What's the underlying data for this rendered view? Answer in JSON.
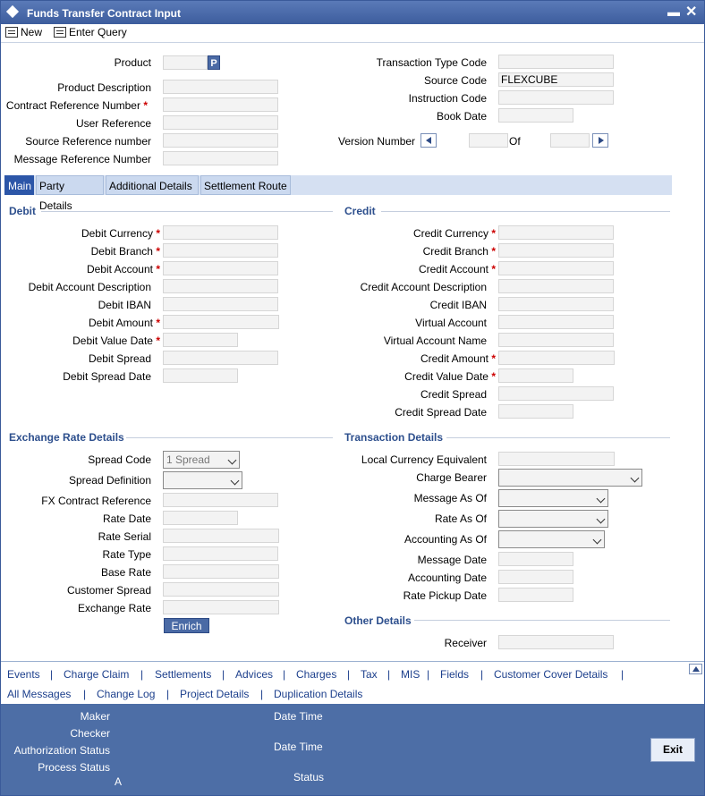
{
  "window": {
    "title": "Funds Transfer Contract Input",
    "minimize": "▬",
    "close": "✕"
  },
  "toolbar": {
    "new": "New",
    "enter_query": "Enter Query"
  },
  "header": {
    "product": "Product",
    "product_btn": "P",
    "product_description": "Product Description",
    "contract_reference_number": "Contract Reference Number",
    "user_reference": "User Reference",
    "source_reference_number": "Source Reference number",
    "message_reference_number": "Message Reference Number",
    "transaction_type_code": "Transaction Type Code",
    "source_code": "Source Code",
    "source_code_value": "FLEXCUBE",
    "instruction_code": "Instruction Code",
    "book_date": "Book Date",
    "version_number": "Version Number",
    "of": "Of"
  },
  "tabs": [
    "Main",
    "Party Details",
    "Additional Details",
    "Settlement Route"
  ],
  "debit": {
    "heading": "Debit",
    "currency": "Debit Currency",
    "branch": "Debit Branch",
    "account": "Debit Account",
    "account_description": "Debit Account Description",
    "iban": "Debit IBAN",
    "amount": "Debit Amount",
    "value_date": "Debit Value Date",
    "spread": "Debit Spread",
    "spread_date": "Debit Spread Date"
  },
  "credit": {
    "heading": "Credit",
    "currency": "Credit Currency",
    "branch": "Credit Branch",
    "account": "Credit Account",
    "account_description": "Credit Account Description",
    "iban": "Credit IBAN",
    "virtual_account": "Virtual Account",
    "virtual_account_name": "Virtual Account Name",
    "amount": "Credit Amount",
    "value_date": "Credit Value Date",
    "spread": "Credit Spread",
    "spread_date": "Credit Spread Date"
  },
  "exchange": {
    "heading": "Exchange Rate Details",
    "spread_code": "Spread Code",
    "spread_code_value": "1 Spread",
    "spread_definition": "Spread Definition",
    "fx_contract_reference": "FX Contract Reference",
    "rate_date": "Rate Date",
    "rate_serial": "Rate Serial",
    "rate_type": "Rate Type",
    "base_rate": "Base Rate",
    "customer_spread": "Customer Spread",
    "exchange_rate": "Exchange Rate",
    "enrich": "Enrich"
  },
  "transaction": {
    "heading": "Transaction Details",
    "local_currency_equivalent": "Local Currency Equivalent",
    "charge_bearer": "Charge Bearer",
    "message_as_of": "Message As Of",
    "rate_as_of": "Rate As Of",
    "accounting_as_of": "Accounting As Of",
    "message_date": "Message Date",
    "accounting_date": "Accounting Date",
    "rate_pickup_date": "Rate Pickup Date"
  },
  "other": {
    "heading": "Other Details",
    "receiver": "Receiver"
  },
  "footer_links": {
    "row1": [
      "Events",
      "Charge Claim",
      "Settlements",
      "Advices",
      "Charges",
      "Tax",
      "MIS",
      "Fields",
      "Customer Cover Details"
    ],
    "row2": [
      "All Messages",
      "Change Log",
      "Project Details",
      "Duplication Details"
    ],
    "separator": "|"
  },
  "status_bar": {
    "maker": "Maker",
    "checker": "Checker",
    "authorization_status": "Authorization Status",
    "process_status": "Process Status",
    "process_status_value": "A",
    "date_time_1": "Date Time",
    "date_time_2": "Date Time",
    "status": "Status",
    "exit": "Exit"
  }
}
